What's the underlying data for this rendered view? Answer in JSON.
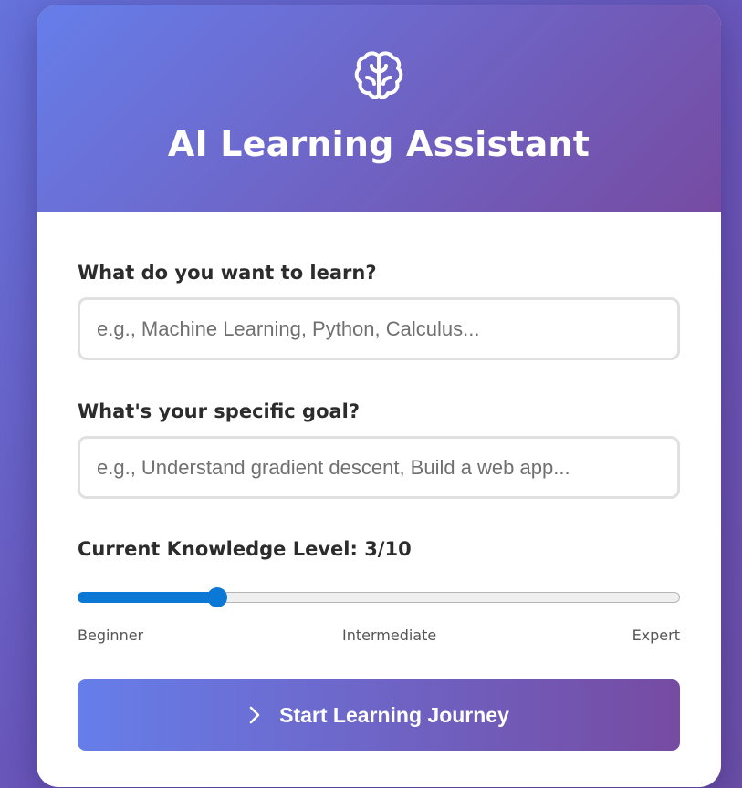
{
  "header": {
    "icon": "brain-icon",
    "title": "AI Learning Assistant"
  },
  "form": {
    "topic": {
      "label": "What do you want to learn?",
      "value": "",
      "placeholder": "e.g., Machine Learning, Python, Calculus..."
    },
    "goal": {
      "label": "What's your specific goal?",
      "value": "",
      "placeholder": "e.g., Understand gradient descent, Build a web app..."
    },
    "knowledge": {
      "label": "Current Knowledge Level: 3/10",
      "value": 3,
      "min": 1,
      "max": 10,
      "scale_labels": {
        "low": "Beginner",
        "mid": "Intermediate",
        "high": "Expert"
      }
    },
    "submit": {
      "icon": "chevron-right-icon",
      "label": "Start Learning Journey"
    }
  },
  "colors": {
    "gradient_start": "#667eea",
    "gradient_end": "#764ba2",
    "slider_accent": "#0c78d5",
    "label_text": "#2c2c2c"
  }
}
